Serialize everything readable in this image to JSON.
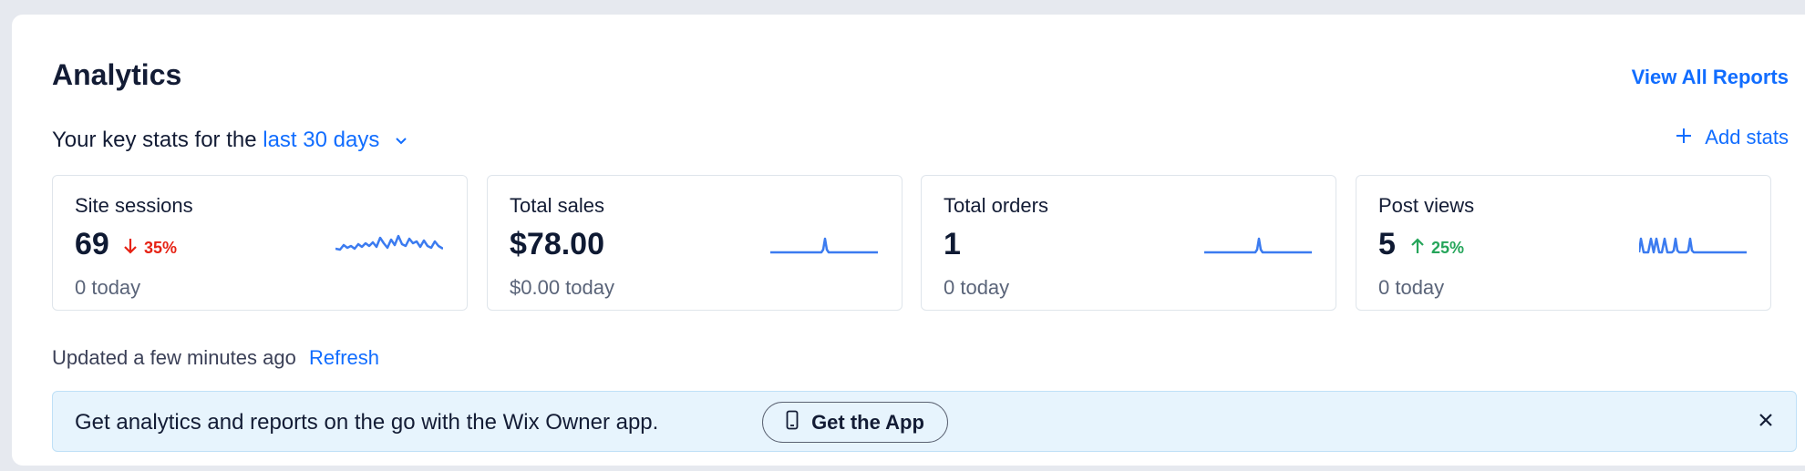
{
  "header": {
    "title": "Analytics",
    "view_all": "View All Reports"
  },
  "subtitle": {
    "prefix": "Your key stats for the",
    "range": "last 30 days"
  },
  "add_stats": "Add stats",
  "cards": [
    {
      "label": "Site sessions",
      "value": "69",
      "trend": "35%",
      "trend_direction": "down",
      "today": "0 today"
    },
    {
      "label": "Total sales",
      "value": "$78.00",
      "today": "$0.00 today"
    },
    {
      "label": "Total orders",
      "value": "1",
      "today": "0 today"
    },
    {
      "label": "Post views",
      "value": "5",
      "trend": "25%",
      "trend_direction": "up",
      "today": "0 today"
    }
  ],
  "updated": {
    "text": "Updated a few minutes ago",
    "refresh": "Refresh"
  },
  "banner": {
    "message": "Get analytics and reports on the go with the Wix Owner app.",
    "button": "Get the App"
  },
  "colors": {
    "accent": "#116dff",
    "down": "#e62214",
    "up": "#25a55a",
    "sparkline": "#3b7bf0",
    "banner_bg": "#e7f4fd"
  },
  "icons": {
    "range_dropdown": "chevron-down-icon",
    "add_stats": "plus-icon",
    "trend_down": "arrow-down-icon",
    "trend_up": "arrow-up-icon",
    "get_app": "phone-icon",
    "banner_close": "close-icon"
  }
}
